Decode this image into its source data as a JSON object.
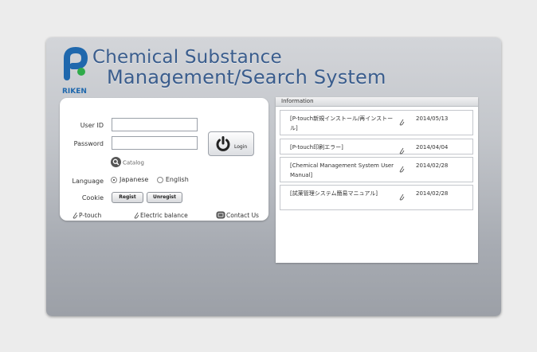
{
  "app": {
    "title_line1": "Chemical Substance",
    "title_line2": "Management/Search System",
    "logo_text": "RIKEN"
  },
  "login": {
    "user_id_label": "User ID",
    "password_label": "Password",
    "user_id_value": "",
    "password_value": "",
    "login_button_label": "Login",
    "catalog_label": "Catalog",
    "language_label": "Language",
    "language_options": [
      "Japanese",
      "English"
    ],
    "language_selected": "Japanese",
    "cookie_label": "Cookie",
    "regist_button": "Regist",
    "unregist_button": "Unregist"
  },
  "footer_links": {
    "ptouch": "P-touch",
    "electric_balance": "Electric balance",
    "contact_us": "Contact Us"
  },
  "information": {
    "header": "Information",
    "items": [
      {
        "title": "[P-touch新規インストール/再インストール]",
        "date": "2014/05/13"
      },
      {
        "title": "[P-touch印刷エラー]",
        "date": "2014/04/04"
      },
      {
        "title": "[Chemical Management System User Manual]",
        "date": "2014/02/28"
      },
      {
        "title": "[試薬管理システム簡易マニュアル]",
        "date": "2014/02/28"
      }
    ]
  },
  "colors": {
    "title": "#3a5d8d",
    "logo_blue": "#1f68ad",
    "logo_green": "#2fab4a"
  }
}
